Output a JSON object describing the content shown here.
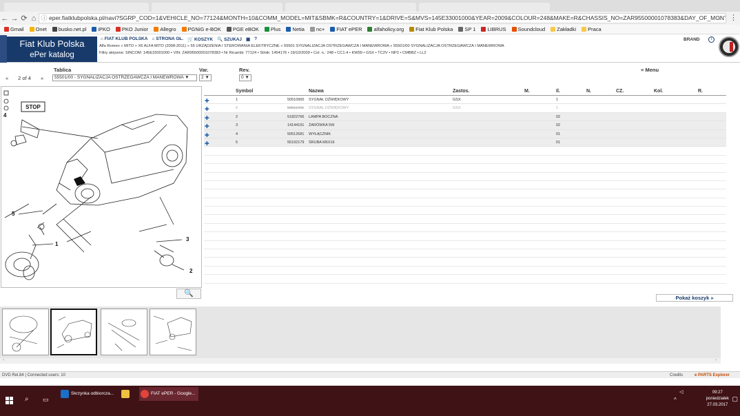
{
  "browser": {
    "url": "eper.fiatklubpolska.pl/navi?SGRP_COD=1&VEHICLE_NO=77124&MONTH=10&COMM_MODEL=MIT&SBMK=R&COUNTRY=1&DRIVE=S&MVS=145E33001000&YEAR=2009&COLOUR=248&MAKE=R&CHASSIS_NO=ZAR95500001078383&DAY_OF_MONTH=19&CAT_COD=X6&",
    "bookmarks": [
      "Gmail",
      "Onet",
      "busko.net.pl",
      "iPKO",
      "PKO Junior",
      "Allegro",
      "PGNiG e-BOK",
      "PGE eBOK",
      "Plus",
      "Netia",
      "nc+",
      "FIAT ePER",
      "alfaholicy.org",
      "Fiat Klub Polska",
      "SP 1",
      "LIBRUS",
      "Soundcloud",
      "Zakładki",
      "Praca"
    ],
    "bookmark_colors": [
      "#d93025",
      "#f6b400",
      "#444",
      "#1a5dab",
      "#d93025",
      "#f57c00",
      "#f57c00",
      "#555",
      "#1a8f3c",
      "#1a5dab",
      "#999",
      "#1a5dab",
      "#2e7d32",
      "#b58b00",
      "#666",
      "#c62828",
      "#e65100",
      "#f9c846",
      "#f9c846"
    ]
  },
  "app": {
    "logo_line1": "Fiat Klub Polska",
    "logo_line2": "ePer katalog",
    "nav": [
      "FIAT KLUB POLSKA",
      "STRONA GŁ.",
      "KOSZYK",
      "SZUKAJ"
    ],
    "breadcrumb": "Alfa Romeo » MITO » X6 ALFA MITO (2008-2011) » 55 URZĄDZENIA I STEROWANIA ELEKTRYCZNE » 55501 SYGNALIZACJA OSTRZEGAWCZA I MANEWROWA » 55501/00 SYGNALIZACJA OSTRZEGAWCZA I MANEWROWA",
    "filters": "Filtry aktywne: SINCOM: 145E33001000 • VIN: ZAR95500001078383 • Nr Ricambi: 77124 • Silnik: 1454176 • 19/10/2009 • Col. n.: 248 • CC1.4 • KW99 • GSX • TC2V • NP2 • CMBBZ • LL2",
    "brand_label": "BRAND",
    "info_glyph": "i"
  },
  "selectors": {
    "tablica_label": "Tablica",
    "var_label": "Var.",
    "rev_label": "Rev.",
    "menu_label": "Menu",
    "prev": "«",
    "page": "2 of 4",
    "next": "»",
    "tablica_value": "55501/00 - SYGNALIZACJA OSTRZEGAWCZA I MANEWROWA ▼",
    "var_value": "2 ▼",
    "rev_value": "0 ▼"
  },
  "diagram": {
    "stop_label": "STOP",
    "callouts": [
      "4",
      "5",
      "1",
      "3",
      "2"
    ]
  },
  "table": {
    "headers": [
      "Symbol",
      "Nazwa",
      "Zastos.",
      "M.",
      "Il.",
      "N.",
      "CZ.",
      "Kol.",
      "R."
    ],
    "rows": [
      {
        "symbol": "1",
        "part": "50510965",
        "name": "SYGNAŁ DŹWIĘKOWY",
        "zastos": "GSX",
        "il": "1"
      },
      {
        "symbol": "6",
        "part": "50511791",
        "name": "SYGNAŁ DŹWIĘKOWY",
        "zastos": "GSX",
        "il": "1"
      },
      {
        "symbol": "2",
        "part": "51822766",
        "name": "LAMPA BOCZNA",
        "zastos": "",
        "il": "02"
      },
      {
        "symbol": "3",
        "part": "14144191",
        "name": "ŻARÓWKA 5W",
        "zastos": "",
        "il": "02"
      },
      {
        "symbol": "4",
        "part": "50512681",
        "name": "WYŁĄCZNIK",
        "zastos": "",
        "il": "01"
      },
      {
        "symbol": "5",
        "part": "55192179",
        "name": "ŚRUBA M6X16",
        "zastos": "",
        "il": "01"
      }
    ]
  },
  "basket_label": "Pokaż koszyk »",
  "status": {
    "left": "DVD Rel.84 | Connected users: 10",
    "credits": "Credits",
    "brand": "e PARTS Explorer"
  },
  "taskbar": {
    "items": [
      "Skrzynka odbiorcza...",
      "",
      "FIAT ePER - Google..."
    ],
    "clock_time": "09:27",
    "clock_day": "poniedziałek",
    "clock_date": "27.03.2017"
  }
}
